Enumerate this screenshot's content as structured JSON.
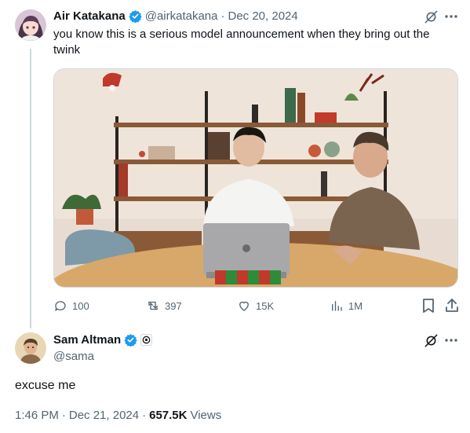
{
  "tweet1": {
    "author_name": "Air Katakana",
    "handle": "@airkatakana",
    "separator": "·",
    "date": "Dec 20, 2024",
    "text": "you know this is a serious model announcement when they bring out the twink",
    "stats": {
      "replies": "100",
      "retweets": "397",
      "likes": "15K",
      "views": "1M"
    }
  },
  "tweet2": {
    "author_name": "Sam Altman",
    "handle": "@sama",
    "text": "excuse me",
    "time": "1:46 PM",
    "separator": "·",
    "date": "Dec 21, 2024",
    "views_count": "657.5K",
    "views_label": "Views"
  },
  "colors": {
    "verified": "#1d9bf0",
    "muted": "#536471",
    "thread_line": "#cfd9de",
    "text": "#0f1419"
  }
}
